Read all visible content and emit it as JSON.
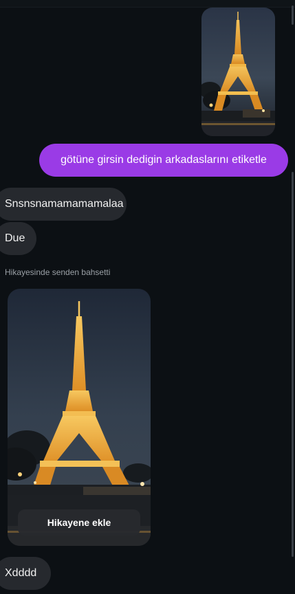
{
  "messages": {
    "outgoing_text": "götüne girsin dedigin arkadaslarını etiketle",
    "incoming_1": "Snsnsnamamamamalaa",
    "incoming_2": "Due",
    "story_mention_note": "Hikayesinde senden bahsetti",
    "incoming_last": "Xdddd"
  },
  "story_card": {
    "add_to_story_label": "Hikayene ekle"
  },
  "colors": {
    "background": "#0c1014",
    "outgoing_bubble": "#9a3be6",
    "incoming_bubble": "#26292e",
    "note_text": "#9aa0a6"
  },
  "icons": [
    "eiffel-tower-photo"
  ]
}
